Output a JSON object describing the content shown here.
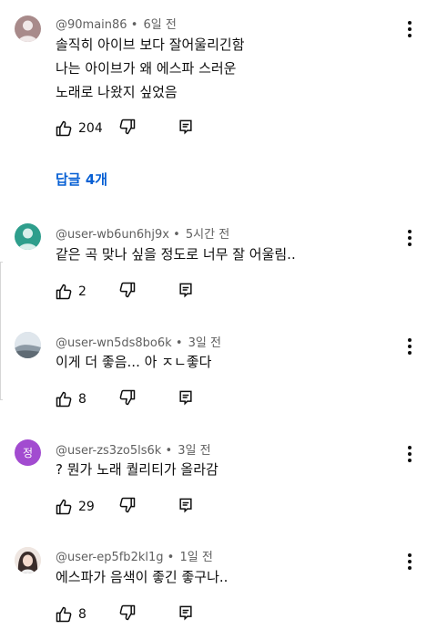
{
  "colors": {
    "link": "#065fd4",
    "meta_text": "#606060",
    "avatar_teal": "#2e9e8c",
    "avatar_purple": "#a24bd0"
  },
  "comments": [
    {
      "author": "@90main86",
      "time": "6일 전",
      "lines": [
        "솔직히 아이브 보다 잘어울리긴함",
        "나는 아이브가 왜 에스파 스러운",
        "노래로 나왔지 싶었음"
      ],
      "likes": "204",
      "avatar_icon": "person-silhouette-icon"
    },
    {
      "author": "@user-wb6un6hj9x",
      "time": "5시간 전",
      "lines": [
        "같은 곡 맞나 싶을 정도로 너무 잘 어울림.."
      ],
      "likes": "2",
      "avatar_icon": "person-silhouette-icon"
    },
    {
      "author": "@user-wn5ds8bo6k",
      "time": "3일 전",
      "lines": [
        "이게 더 좋음... 아 ㅈㄴ좋다"
      ],
      "likes": "8",
      "avatar_icon": "landscape-photo-icon"
    },
    {
      "author": "@user-zs3zo5ls6k",
      "time": "3일 전",
      "lines": [
        "? 뭔가 노래 퀄리티가 올라감"
      ],
      "likes": "29",
      "avatar_letter": "정"
    },
    {
      "author": "@user-ep5fb2kl1g",
      "time": "1일 전",
      "lines": [
        "에스파가 음색이 좋긴 좋구나.."
      ],
      "likes": "8",
      "avatar_icon": "profile-photo-icon"
    }
  ],
  "replies_link": "답글 4개"
}
